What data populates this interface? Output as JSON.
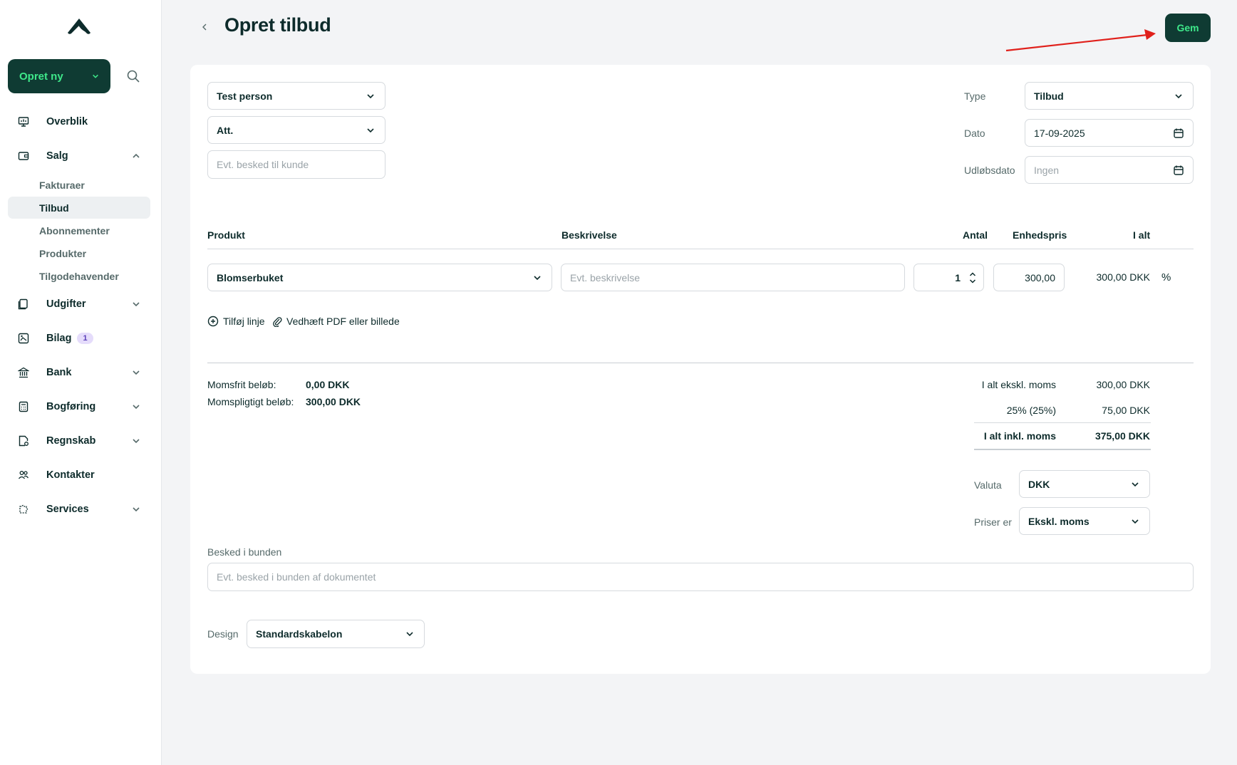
{
  "sidebar": {
    "create_label": "Opret ny",
    "items": [
      {
        "label": "Overblik"
      },
      {
        "label": "Salg"
      },
      {
        "label": "Udgifter"
      },
      {
        "label": "Bilag",
        "badge": "1"
      },
      {
        "label": "Bank"
      },
      {
        "label": "Bogføring"
      },
      {
        "label": "Regnskab"
      },
      {
        "label": "Kontakter"
      },
      {
        "label": "Services"
      }
    ],
    "sub_items": [
      {
        "label": "Fakturaer"
      },
      {
        "label": "Tilbud"
      },
      {
        "label": "Abonnementer"
      },
      {
        "label": "Produkter"
      },
      {
        "label": "Tilgodehavender"
      }
    ]
  },
  "header": {
    "title": "Opret tilbud",
    "save_label": "Gem"
  },
  "form": {
    "customer": "Test person",
    "att": "Att.",
    "message_placeholder": "Evt. besked til kunde",
    "type_label": "Type",
    "type_value": "Tilbud",
    "date_label": "Dato",
    "date_value": "17-09-2025",
    "expiry_label": "Udløbsdato",
    "expiry_placeholder": "Ingen"
  },
  "lines": {
    "headers": {
      "product": "Produkt",
      "description": "Beskrivelse",
      "quantity": "Antal",
      "unit_price": "Enhedspris",
      "total": "I alt"
    },
    "rows": [
      {
        "product": "Blomserbuket",
        "description_placeholder": "Evt. beskrivelse",
        "quantity": "1",
        "unit_price": "300,00",
        "total": "300,00 DKK",
        "discount_symbol": "%"
      }
    ],
    "add_line": "Tilføj linje",
    "attach": "Vedhæft PDF eller billede"
  },
  "totals": {
    "vat_free_label": "Momsfrit beløb:",
    "vat_free_value": "0,00 DKK",
    "vat_liable_label": "Momspligtigt beløb:",
    "vat_liable_value": "300,00 DKK",
    "excl_label": "I alt ekskl. moms",
    "excl_value": "300,00 DKK",
    "vat_label": "25% (25%)",
    "vat_value": "75,00 DKK",
    "incl_label": "I alt inkl. moms",
    "incl_value": "375,00 DKK",
    "currency_label": "Valuta",
    "currency_value": "DKK",
    "prices_label": "Priser er",
    "prices_value": "Ekskl. moms"
  },
  "footer": {
    "bottom_message_label": "Besked i bunden",
    "bottom_message_placeholder": "Evt. besked i bunden af dokumentet",
    "design_label": "Design",
    "design_value": "Standardskabelon"
  },
  "colors": {
    "brand_dark": "#0f3b33",
    "brand_accent": "#3ee88a",
    "annotation_arrow": "#e0201b"
  }
}
